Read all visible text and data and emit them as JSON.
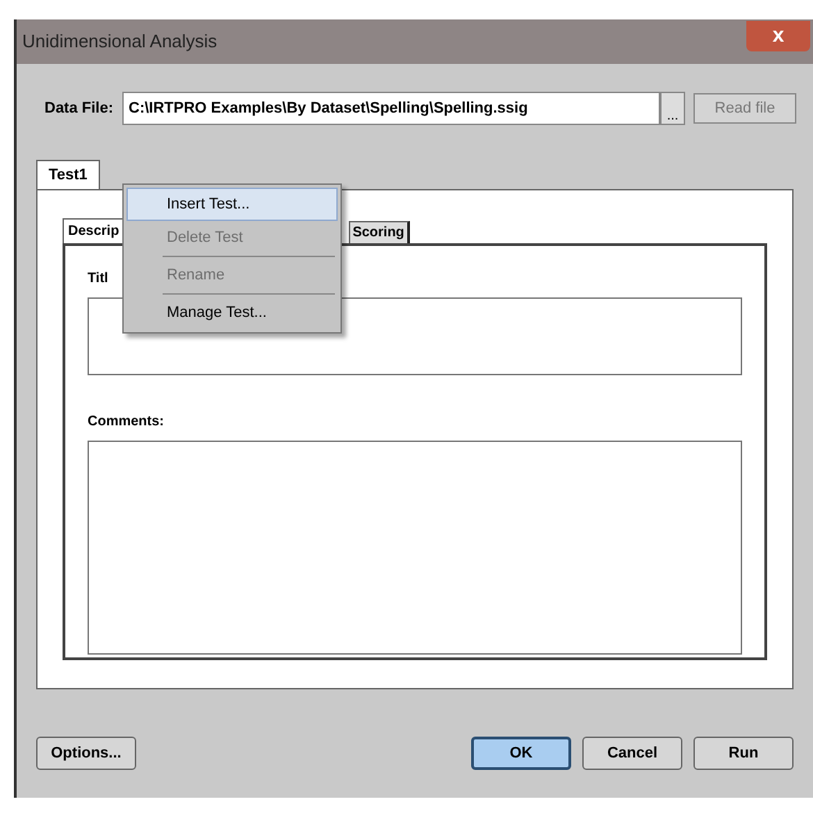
{
  "window": {
    "title": "Unidimensional Analysis",
    "close": "x"
  },
  "data_file": {
    "label": "Data File:",
    "value": "C:\\IRTPRO Examples\\By Dataset\\Spelling\\Spelling.ssig",
    "browse": "...",
    "read_button": {
      "label": "Read file",
      "disabled": true
    }
  },
  "outer_tabs": [
    {
      "label": "Test1",
      "selected": true
    }
  ],
  "inner_tabs": [
    {
      "label": "Descrip",
      "selected": true
    },
    {
      "label": "Scoring",
      "selected": false
    }
  ],
  "fields": [
    {
      "label": "Titl",
      "kind": "single"
    },
    {
      "label": "Comments:",
      "kind": "multi"
    }
  ],
  "context_menu": [
    {
      "label": "Insert Test...",
      "disabled": false,
      "selected": true
    },
    {
      "label": "Delete Test",
      "disabled": true,
      "selected": false
    },
    {
      "label": "Rename",
      "disabled": true,
      "selected": false
    },
    {
      "label": "Manage Test...",
      "disabled": false,
      "selected": false
    }
  ],
  "left_buttons": [
    {
      "label": "Options...",
      "default": false
    }
  ],
  "right_buttons": [
    {
      "label": "OK",
      "default": true
    },
    {
      "label": "Cancel",
      "default": false
    },
    {
      "label": "Run",
      "default": false
    }
  ]
}
